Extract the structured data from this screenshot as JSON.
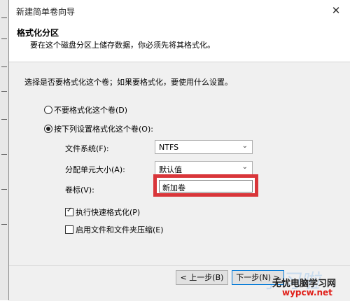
{
  "dialog": {
    "title": "新建简单卷向导",
    "close_glyph": "✕"
  },
  "header": {
    "title": "格式化分区",
    "subtitle": "要在这个磁盘分区上储存数据，你必须先将其格式化。"
  },
  "content": {
    "prompt": "选择是否要格式化这个卷；如果要格式化，要使用什么设置。",
    "radio_no_format": {
      "label": "不要格式化这个卷(D)",
      "selected": false
    },
    "radio_format": {
      "label": "按下列设置格式化这个卷(O):",
      "selected": true
    },
    "file_system": {
      "label": "文件系统(F):",
      "value": "NTFS"
    },
    "alloc_unit": {
      "label": "分配单元大小(A):",
      "value": "默认值"
    },
    "volume_label": {
      "label": "卷标(V):",
      "value": "新加卷"
    },
    "quick_format": {
      "label": "执行快速格式化(P)",
      "checked": true,
      "tick": "✓"
    },
    "compression": {
      "label": "启用文件和文件夹压缩(E)",
      "checked": false
    }
  },
  "footer": {
    "back_label": "< 上一步(B)",
    "next_label": "下一步(N) >"
  },
  "watermark": {
    "big": "学习啦",
    "brand": "无忧电脑学习网",
    "url": "wypcw.net"
  },
  "colors": {
    "highlight": "#d9363a",
    "accent": "#0078d7"
  }
}
